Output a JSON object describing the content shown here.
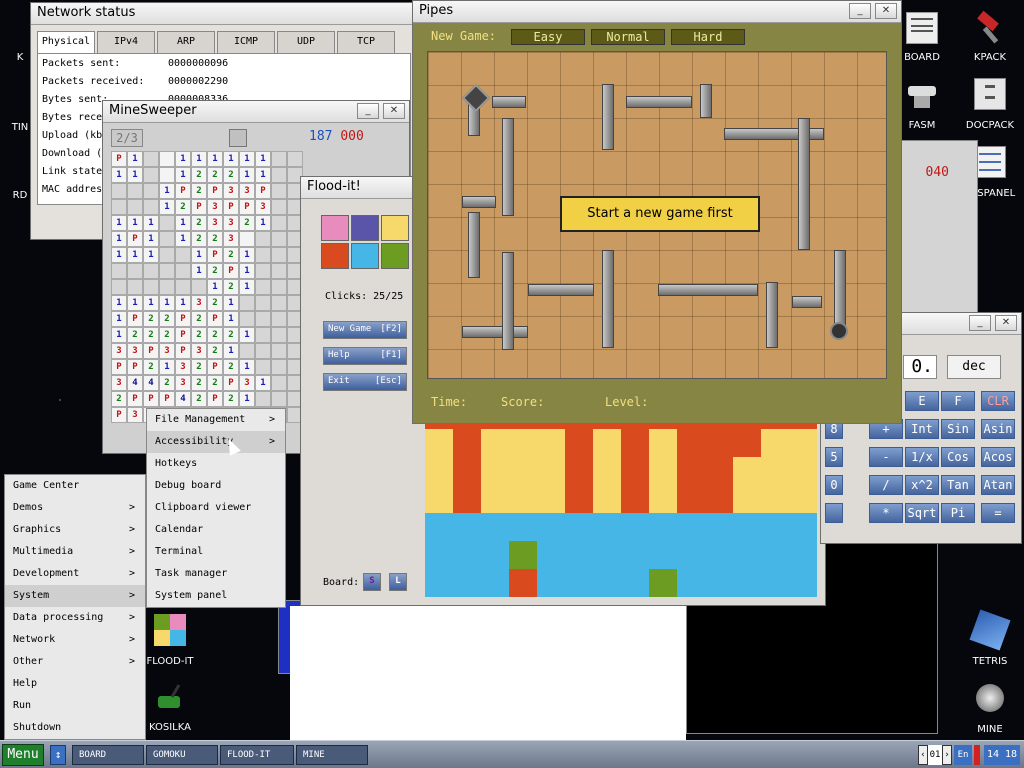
{
  "desktop": {
    "icons": [
      {
        "id": "board",
        "label": "BOARD"
      },
      {
        "id": "kpack",
        "label": "KPACK"
      },
      {
        "id": "fasm",
        "label": "FASM"
      },
      {
        "id": "docpack",
        "label": "DOCPACK"
      },
      {
        "id": "syspanel",
        "label": "SYSPANEL"
      },
      {
        "id": "floodit",
        "label": "FLOOD-IT"
      },
      {
        "id": "kosilka",
        "label": "KOSILKA"
      },
      {
        "id": "tetris",
        "label": "TETRIS"
      },
      {
        "id": "mine",
        "label": "MINE"
      }
    ],
    "partial_labels": {
      "k": "K",
      "tin": "TIN",
      "rd": "RD"
    }
  },
  "network": {
    "title": "Network status",
    "tabs": [
      "Physical",
      "IPv4",
      "ARP",
      "ICMP",
      "UDP",
      "TCP"
    ],
    "rows": [
      {
        "label": "Packets sent:",
        "value": "0000000096"
      },
      {
        "label": "Packets received:",
        "value": "0000002290"
      },
      {
        "label": "Bytes sent:",
        "value": "0000008336"
      },
      {
        "label": "Bytes rece",
        "value": ""
      },
      {
        "label": "Upload (kb",
        "value": ""
      },
      {
        "label": "Download (",
        "value": ""
      },
      {
        "label": "Link state",
        "value": ""
      },
      {
        "label": "MAC addres",
        "value": ""
      }
    ]
  },
  "minesweeper": {
    "title": "MineSweeper",
    "counter": "2/3",
    "score_blue": "187",
    "score_red": "000",
    "rows": [
      "P1 ·111111",
      "11 ·122211",
      "   1P2P33P",
      "   12P3PP3",
      "111 123321",
      "1P1 1223· ",
      "111  1P21 ",
      "     12P1 ",
      "      121 ",
      "11111321  ",
      "1P22P2P1  ",
      "1222P2221 ",
      "33P3P321  ",
      "PP2132P21 ",
      "3442322P31",
      "2PPP42P21 ",
      "P3P4P22112"
    ]
  },
  "flood": {
    "title": "Flood-it!",
    "colors": [
      "#e88bbd",
      "#5a55a8",
      "#f6d96a",
      "#d94b1f",
      "#46b6e6",
      "#6c9c22"
    ],
    "clicks_label": "Clicks: 25/25",
    "buttons": [
      {
        "label": "New Game",
        "key": "[F2]"
      },
      {
        "label": "Help",
        "key": "[F1]"
      },
      {
        "label": "Exit",
        "key": "[Esc]"
      }
    ],
    "board_label": "Board:",
    "size_s": "S",
    "size_l": "L"
  },
  "pipes": {
    "title": "Pipes",
    "new_game_label": "New Game:",
    "levels": [
      "Easy",
      "Normal",
      "Hard"
    ],
    "message": "Start a new game first",
    "time_label": "Time:",
    "score_label": "Score:",
    "level_label": "Level:"
  },
  "calculator": {
    "display": "0.",
    "mode": "dec",
    "rows": [
      [
        "E",
        "F",
        "CLR"
      ],
      [
        "+",
        "Int",
        "Sin",
        "Asin"
      ],
      [
        "-",
        "1/x",
        "Cos",
        "Acos"
      ],
      [
        "/",
        "x^2",
        "Tan",
        "Atan"
      ],
      [
        "*",
        "Sqrt",
        "Pi",
        "="
      ]
    ],
    "partial_left": [
      "8",
      "5",
      "0",
      ""
    ]
  },
  "hidden_counter": "040",
  "menu": {
    "main": [
      {
        "label": "Game Center",
        "arrow": ""
      },
      {
        "label": "Demos",
        "arrow": ">"
      },
      {
        "label": "Graphics",
        "arrow": ">"
      },
      {
        "label": "Multimedia",
        "arrow": ">"
      },
      {
        "label": "Development",
        "arrow": ">"
      },
      {
        "label": "System",
        "arrow": ">"
      },
      {
        "label": "Data processing",
        "arrow": ">"
      },
      {
        "label": "Network",
        "arrow": ">"
      },
      {
        "label": "Other",
        "arrow": ">"
      },
      {
        "label": "Help",
        "arrow": ""
      },
      {
        "label": "Run",
        "arrow": ""
      },
      {
        "label": "Shutdown",
        "arrow": ""
      }
    ],
    "system": [
      {
        "label": "File Management",
        "arrow": ">"
      },
      {
        "label": "Accessibility",
        "arrow": ">"
      },
      {
        "label": "Hotkeys",
        "arrow": ""
      },
      {
        "label": "Debug board",
        "arrow": ""
      },
      {
        "label": "Clipboard viewer",
        "arrow": ""
      },
      {
        "label": "Calendar",
        "arrow": ""
      },
      {
        "label": "Terminal",
        "arrow": ""
      },
      {
        "label": "Task manager",
        "arrow": ""
      },
      {
        "label": "System panel",
        "arrow": ""
      }
    ]
  },
  "taskbar": {
    "menu_label": "Menu",
    "tasks": [
      "BOARD",
      "GOMOKU",
      "FLOOD-IT",
      "MINE"
    ],
    "page": "01",
    "lang": "En",
    "clock": "14 18"
  }
}
